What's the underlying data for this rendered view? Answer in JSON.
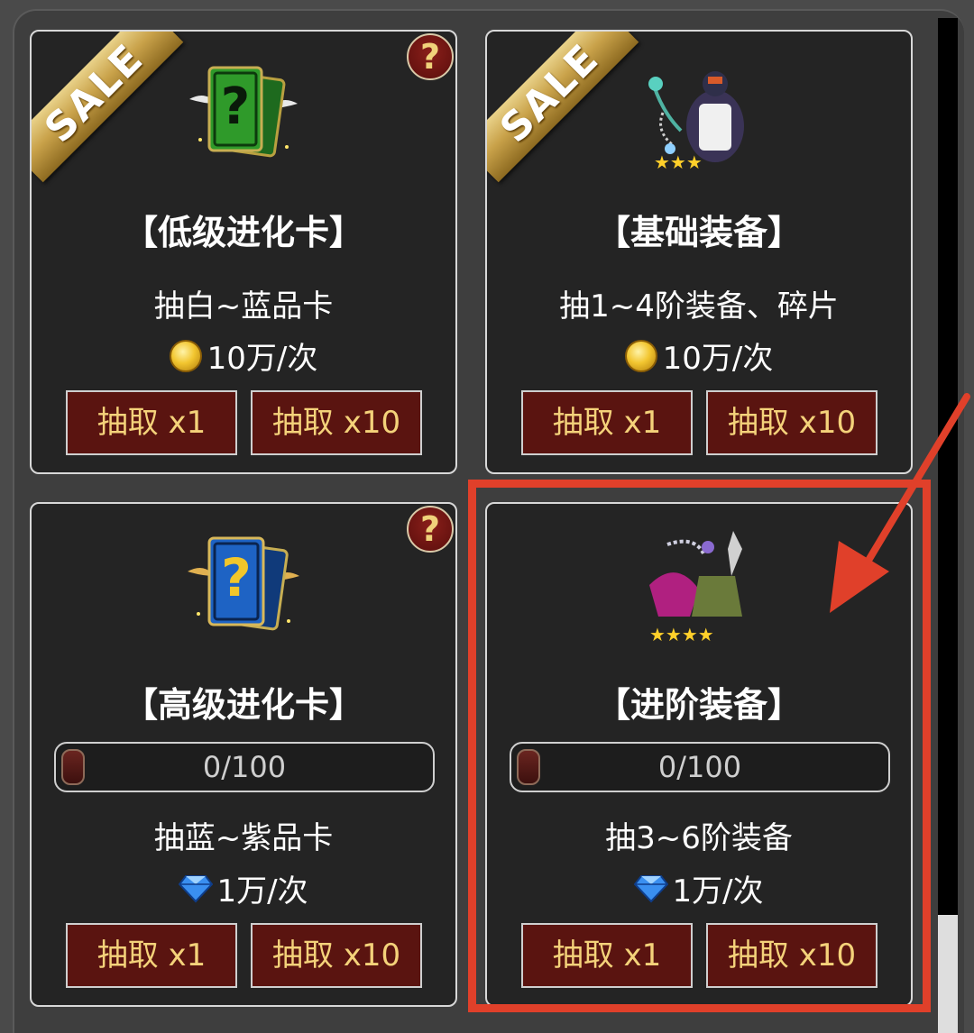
{
  "colors": {
    "panel_bg": "#3e3e3e",
    "card_bg": "#242424",
    "button_bg": "#5a1410",
    "button_text": "#f4d27a",
    "highlight": "#e0402a"
  },
  "cards": [
    {
      "sale": "SALE",
      "help": "?",
      "icon": "green-mystery-card-icon",
      "title": "【低级进化卡】",
      "desc": "抽白~蓝品卡",
      "cost_icon": "gold-coin-icon",
      "cost": "10万/次",
      "btn1": "抽取 x1",
      "btn10": "抽取 x10"
    },
    {
      "sale": "SALE",
      "icon": "basic-equipment-icon",
      "title": "【基础装备】",
      "desc": "抽1~4阶装备、碎片",
      "cost_icon": "gold-coin-icon",
      "cost": "10万/次",
      "btn1": "抽取 x1",
      "btn10": "抽取 x10"
    },
    {
      "help": "?",
      "icon": "blue-mystery-card-icon",
      "title": "【高级进化卡】",
      "progress": "0/100",
      "progress_value": 0,
      "desc": "抽蓝~紫品卡",
      "cost_icon": "diamond-icon",
      "cost": "1万/次",
      "btn1": "抽取 x1",
      "btn10": "抽取 x10"
    },
    {
      "icon": "advanced-equipment-icon",
      "title": "【进阶装备】",
      "progress": "0/100",
      "progress_value": 0,
      "desc": "抽3~6阶装备",
      "cost_icon": "diamond-icon",
      "cost": "1万/次",
      "btn1": "抽取 x1",
      "btn10": "抽取 x10"
    }
  ]
}
